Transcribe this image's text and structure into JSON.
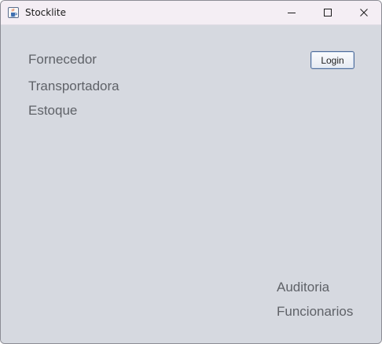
{
  "window": {
    "title": "Stocklite",
    "icons": {
      "app": "java-cup-icon",
      "minimize": "minimize-icon",
      "maximize": "maximize-icon",
      "close": "close-icon"
    }
  },
  "menu": {
    "items": [
      {
        "label": "Fornecedor"
      },
      {
        "label": "Transportadora"
      },
      {
        "label": "Estoque"
      }
    ],
    "bottom_items": [
      {
        "label": "Auditoria"
      },
      {
        "label": "Funcionarios"
      }
    ]
  },
  "actions": {
    "login_label": "Login"
  },
  "colors": {
    "background": "#d6d9e0",
    "titlebar": "#f4eef4",
    "link_text": "#5f6268",
    "button_border": "#4f6d9a"
  }
}
